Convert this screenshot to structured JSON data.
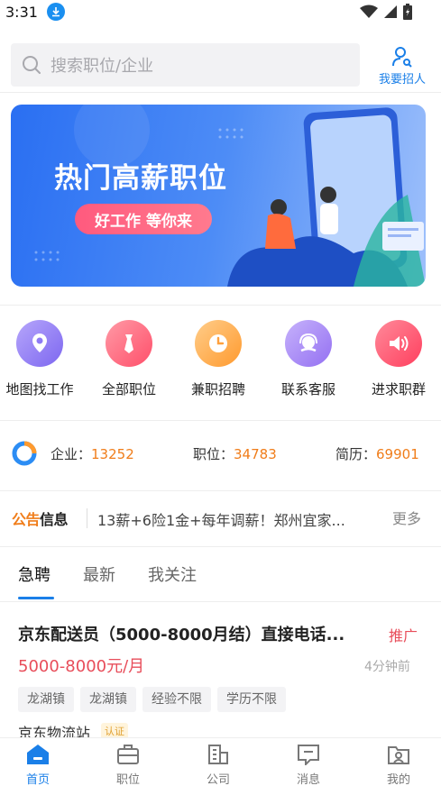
{
  "status_bar": {
    "time": "3:31"
  },
  "search": {
    "placeholder": "搜索职位/企业",
    "recruit_label": "我要招人"
  },
  "banner": {
    "title": "热门高薪职位",
    "pill": "好工作 等你来"
  },
  "quick_actions": [
    {
      "label": "地图找工作",
      "icon": "map-pin-icon",
      "color": "#8e7bf5"
    },
    {
      "label": "全部职位",
      "icon": "tie-icon",
      "color": "#ff5a6e"
    },
    {
      "label": "兼职招聘",
      "icon": "clock-icon",
      "color": "#ffa13d"
    },
    {
      "label": "联系客服",
      "icon": "support-agent-icon",
      "color": "#a57ff5"
    },
    {
      "label": "进求职群",
      "icon": "speaker-icon",
      "color": "#ff4f6a"
    }
  ],
  "stats": {
    "company_label": "企业：",
    "company_value": "13252",
    "position_label": "职位：",
    "position_value": "34783",
    "resume_label": "简历：",
    "resume_value": "69901"
  },
  "notice": {
    "brand_part1": "公告",
    "brand_part2": "信息",
    "text": "13薪+6险1金+每年调薪！郑州宜家...",
    "more": "更多"
  },
  "tabs": [
    {
      "label": "急聘",
      "active": true
    },
    {
      "label": "最新",
      "active": false
    },
    {
      "label": "我关注",
      "active": false
    }
  ],
  "job": {
    "title": "京东配送员（5000-8000月结）直接电话...",
    "promo": "推广",
    "salary": "5000-8000元/月",
    "posted": "4分钟前",
    "tags": [
      "龙湖镇",
      "龙湖镇",
      "经验不限",
      "学历不限"
    ],
    "company": "京东物流站",
    "company_badge": "认证"
  },
  "bottom_nav": [
    {
      "label": "首页",
      "icon": "home-icon",
      "active": true
    },
    {
      "label": "职位",
      "icon": "briefcase-icon",
      "active": false
    },
    {
      "label": "公司",
      "icon": "building-icon",
      "active": false
    },
    {
      "label": "消息",
      "icon": "message-icon",
      "active": false
    },
    {
      "label": "我的",
      "icon": "profile-icon",
      "active": false
    }
  ],
  "colors": {
    "accent": "#1a7fe8",
    "salary": "#e84d5a",
    "stat_number": "#f07d1a",
    "notice_brand_1": "#f07d1a",
    "notice_brand_2": "#222222"
  }
}
